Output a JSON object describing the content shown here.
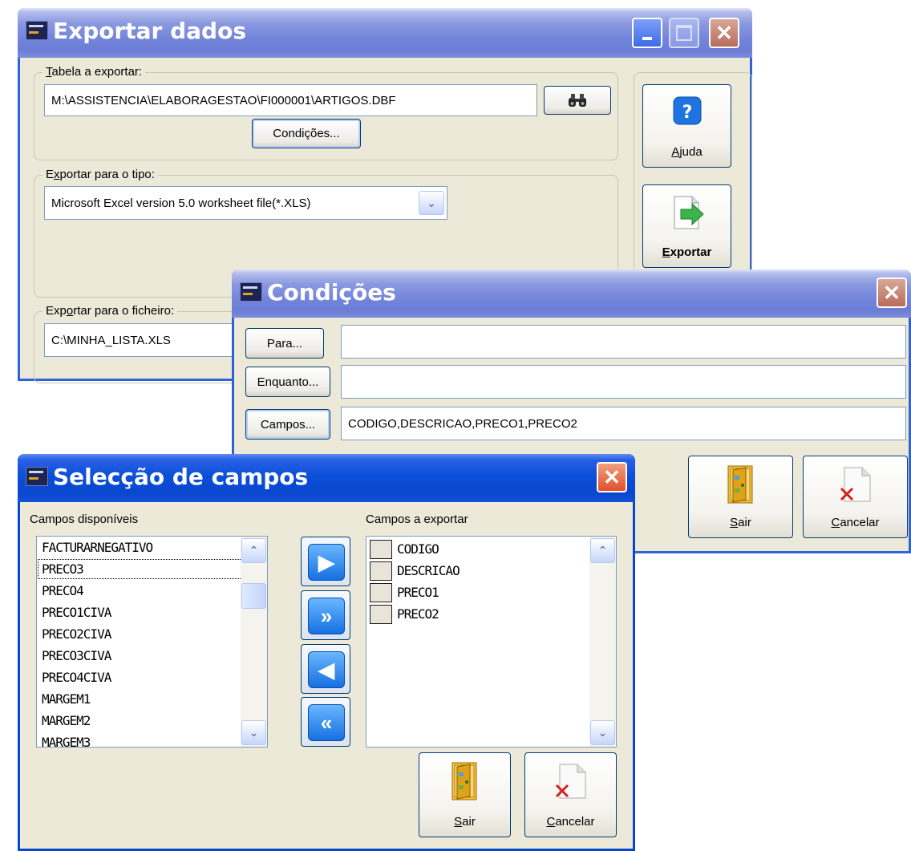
{
  "export_window": {
    "title": "Exportar dados",
    "group_table_label_pre": "",
    "group_table_label_key": "T",
    "group_table_label_post": "abela a exportar:",
    "table_path": "M:\\ASSISTENCIA\\ELABORAGESTAO\\FI000001\\ARTIGOS.DBF",
    "binoculars_icon": "binoculars-icon",
    "conditions_button": "Condições...",
    "group_type_label_pre": "E",
    "group_type_label_key": "x",
    "group_type_label_post": "portar para o tipo:",
    "type_value": "Microsoft Excel version 5.0 worksheet file(*.XLS)",
    "group_file_label_pre": "Exp",
    "group_file_label_key": "o",
    "group_file_label_post": "rtar para o ficheiro:",
    "file_value": "C:\\MINHA_LISTA.XLS",
    "help_button_key": "A",
    "help_button_rest": "juda",
    "export_button_key": "E",
    "export_button_rest": "xportar"
  },
  "conditions_window": {
    "title": "Condições",
    "para_button": "Para...",
    "para_value": "",
    "enquanto_button": "Enquanto...",
    "enquanto_value": "",
    "campos_button": "Campos...",
    "campos_value": "CODIGO,DESCRICAO,PRECO1,PRECO2",
    "exit_key": "S",
    "exit_rest": "air",
    "cancel_key": "C",
    "cancel_rest": "ancelar"
  },
  "fields_window": {
    "title": "Selecção de campos",
    "available_label": "Campos disponíveis",
    "export_label": "Campos a exportar",
    "available_fields": [
      "FACTURARNEGATIVO",
      "PRECO3",
      "PRECO4",
      "PRECO1CIVA",
      "PRECO2CIVA",
      "PRECO3CIVA",
      "PRECO4CIVA",
      "MARGEM1",
      "MARGEM2",
      "MARGEM3"
    ],
    "selected_available_index": 1,
    "export_fields": [
      "CODIGO",
      "DESCRICAO",
      "PRECO1",
      "PRECO2"
    ],
    "move_buttons": [
      "move-one-right-icon",
      "move-all-right-icon",
      "move-one-left-icon",
      "move-all-left-icon"
    ],
    "exit_key": "S",
    "exit_rest": "air",
    "cancel_key": "C",
    "cancel_rest": "ancelar"
  }
}
